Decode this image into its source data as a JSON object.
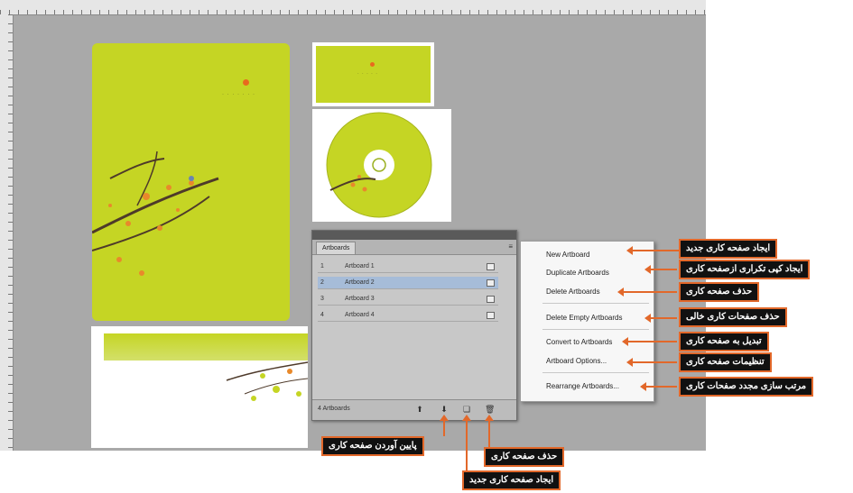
{
  "panel": {
    "tab_label": "Artboards",
    "menu_icon": "panel-menu-icon",
    "rows": [
      {
        "num": "1",
        "name": "Artboard 1"
      },
      {
        "num": "2",
        "name": "Artboard 2"
      },
      {
        "num": "3",
        "name": "Artboard 3"
      },
      {
        "num": "4",
        "name": "Artboard 4"
      }
    ],
    "selected_row": 2,
    "count": "4 Artboards"
  },
  "menu": {
    "items": [
      "New Artboard",
      "Duplicate Artboards",
      "Delete Artboards",
      "Delete Empty Artboards",
      "Convert to Artboards",
      "Artboard Options...",
      "Rearrange Artboards..."
    ]
  },
  "callouts": {
    "new_artboard": "ایجاد صفحه کاری جدید",
    "duplicate": "ایجاد کپی تکراری ازصفحه کاری",
    "delete": "حذف صفحه کاری",
    "delete_empty": "حذف صفحات کاری خالی",
    "convert": "تبدیل به صفحه کاری",
    "options": "تنظیمات صفحه کاری",
    "rearrange": "مرتب سازی مجدد صفحات کاری",
    "move_down": "پایین آوردن صفحه کاری",
    "footer_delete": "حذف صفحه کاری",
    "footer_new": "ایجاد صفحه کاری جدید"
  },
  "colors": {
    "artboard_green": "#c5d524",
    "callout_border": "#e2682a",
    "callout_bg": "#111111"
  }
}
